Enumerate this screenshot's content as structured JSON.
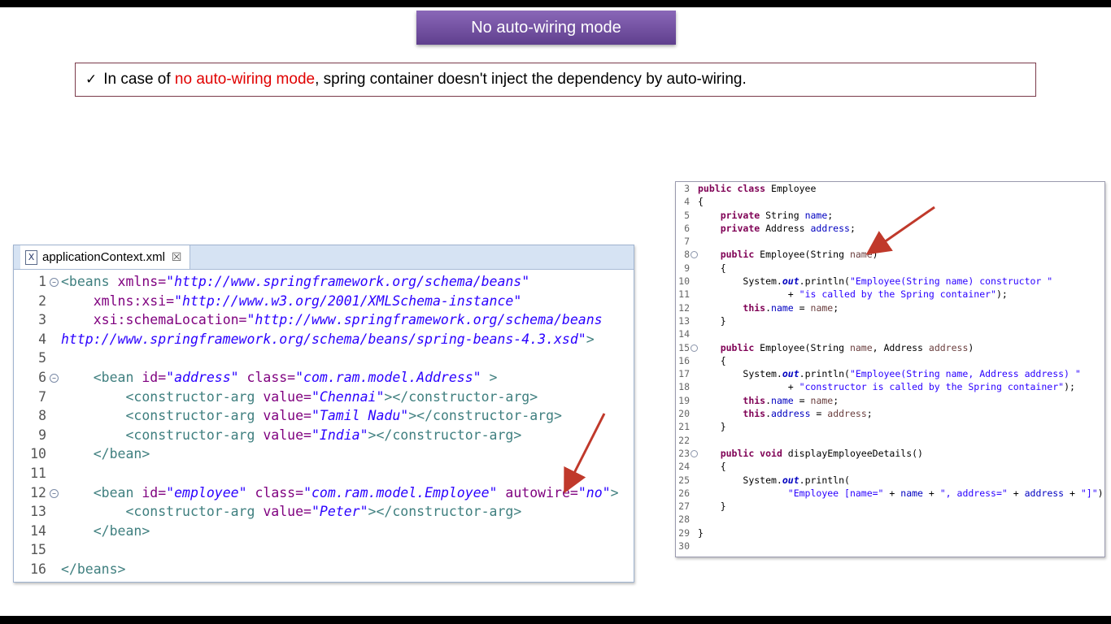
{
  "slide": {
    "title": "No auto-wiring mode",
    "bullet": {
      "check": "✓",
      "prefix": "In case of ",
      "highlight": "no auto-wiring mode",
      "suffix": ", spring container doesn't inject the dependency by auto-wiring."
    },
    "accent_color": "#e00000",
    "title_color": "#6b4a9b"
  },
  "xml_editor": {
    "tab_label": "applicationContext.xml",
    "tab_close": "☒",
    "line_numbers": [
      "1",
      "2",
      "3",
      "4",
      "5",
      "6",
      "7",
      "8",
      "9",
      "10",
      "11",
      "12",
      "13",
      "14",
      "15",
      "16"
    ],
    "l1_tag": "<beans ",
    "l1_attr": "xmlns=",
    "l1_val": "\"http://www.springframework.org/schema/beans\"",
    "l2_attr": "xmlns:xsi=",
    "l2_val": "\"http://www.w3.org/2001/XMLSchema-instance\"",
    "l3_attr": "xsi:schemaLocation=",
    "l3_val": "\"http://www.springframework.org/schema/beans",
    "l4_val": "http://www.springframework.org/schema/beans/spring-beans-4.3.xsd\"",
    "l4_end": ">",
    "l6_tag": "<bean ",
    "l6_attr1": "id=",
    "l6_val1": "\"address\"",
    "l6_attr2": " class=",
    "l6_val2": "\"com.ram.model.Address\"",
    "l6_end": " >",
    "l7_tag": "<constructor-arg ",
    "l7_attr": "value=",
    "l7_val": "\"Chennai\"",
    "l7_end": "></constructor-arg>",
    "l8_tag": "<constructor-arg ",
    "l8_attr": "value=",
    "l8_val": "\"Tamil Nadu\"",
    "l8_end": "></constructor-arg>",
    "l9_tag": "<constructor-arg ",
    "l9_attr": "value=",
    "l9_val": "\"India\"",
    "l9_end": "></constructor-arg>",
    "l10_tag": "</bean>",
    "l12_tag": "<bean ",
    "l12_attr1": "id=",
    "l12_val1": "\"employee\"",
    "l12_attr2": " class=",
    "l12_val2": "\"com.ram.model.Employee\"",
    "l12_attr3": " autowire=",
    "l12_val3": "\"no\"",
    "l12_end": ">",
    "l13_tag": "<constructor-arg ",
    "l13_attr": "value=",
    "l13_val": "\"Peter\"",
    "l13_end": "></constructor-arg>",
    "l14_tag": "</bean>",
    "l16_tag": "</beans>"
  },
  "java_editor": {
    "line_numbers": [
      "3",
      "4",
      "5",
      "6",
      "7",
      "8",
      "9",
      "10",
      "11",
      "12",
      "13",
      "14",
      "15",
      "16",
      "17",
      "18",
      "19",
      "20",
      "21",
      "22",
      "23",
      "24",
      "25",
      "26",
      "27",
      "28",
      "29",
      "30"
    ],
    "j3_kw": "public class",
    "j3_rest": " Employee",
    "j4": "{",
    "j5_kw": "private",
    "j5_type": " String ",
    "j5_fld": "name",
    "j5_end": ";",
    "j6_kw": "private",
    "j6_type": " Address ",
    "j6_fld": "address",
    "j6_end": ";",
    "j8_kw": "public",
    "j8_rest": " Employee(String ",
    "j8_par": "name",
    "j8_end": ")",
    "j9": "{",
    "j10_sys": "System.",
    "j10_out": "out",
    "j10_rest": ".println(",
    "j10_str": "\"Employee(String name) constructor \"",
    "j11_plus": "+ ",
    "j11_str": "\"is called by the Spring container\"",
    "j11_end": ");",
    "j12_kw": "this",
    "j12_rest": ".",
    "j12_fld": "name",
    "j12_eq": " = ",
    "j12_par": "name",
    "j12_end": ";",
    "j13": "}",
    "j15_kw": "public",
    "j15_rest": " Employee(String ",
    "j15_par1": "name",
    "j15_mid": ", Address ",
    "j15_par2": "address",
    "j15_end": ")",
    "j16": "{",
    "j17_sys": "System.",
    "j17_out": "out",
    "j17_rest": ".println(",
    "j17_str": "\"Employee(String name, Address address) \"",
    "j18_plus": "+ ",
    "j18_str": "\"constructor is called by the Spring container\"",
    "j18_end": ");",
    "j19_kw": "this",
    "j19_rest": ".",
    "j19_fld": "name",
    "j19_eq": " = ",
    "j19_par": "name",
    "j19_end": ";",
    "j20_kw": "this",
    "j20_rest": ".",
    "j20_fld": "address",
    "j20_eq": " = ",
    "j20_par": "address",
    "j20_end": ";",
    "j21": "}",
    "j23_kw": "public void",
    "j23_rest": " displayEmployeeDetails()",
    "j24": "{",
    "j25_sys": "System.",
    "j25_out": "out",
    "j25_rest": ".println(",
    "j26_str1": "\"Employee [name=\"",
    "j26_a": " + ",
    "j26_f1": "name",
    "j26_b": " + ",
    "j26_str2": "\", address=\"",
    "j26_c": " + ",
    "j26_f2": "address",
    "j26_d": " + ",
    "j26_str3": "\"]\"",
    "j26_end": ");",
    "j27": "}",
    "j29": "}"
  }
}
